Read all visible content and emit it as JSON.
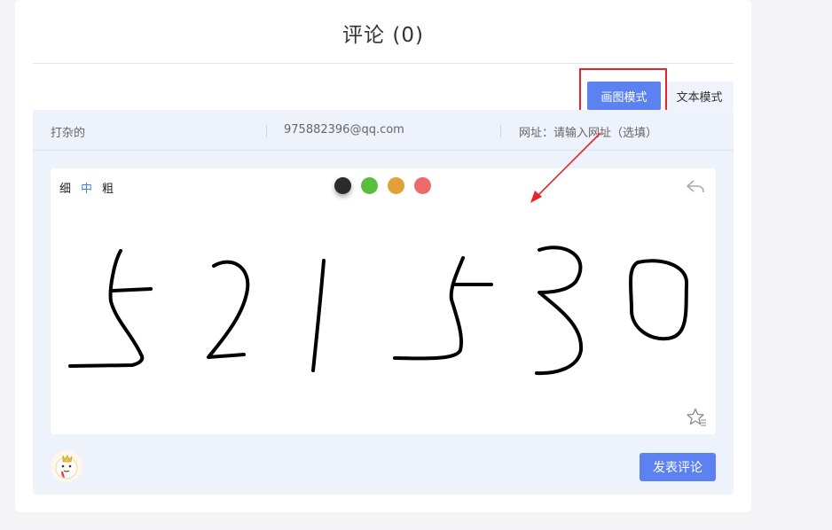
{
  "comments": {
    "title": "评论 (0)"
  },
  "mode_tabs": [
    {
      "label": "画图模式",
      "active": true
    },
    {
      "label": "文本模式",
      "active": false
    }
  ],
  "form": {
    "nickname": "打杂的",
    "email": "975882396@qq.com",
    "website_placeholder": "网址：请输入网址（选填）"
  },
  "brush_sizes": [
    {
      "label": "细",
      "active": false
    },
    {
      "label": "中",
      "active": true
    },
    {
      "label": "粗",
      "active": false
    }
  ],
  "pen_colors": [
    "#2b2b2b",
    "#5bbd3e",
    "#e3a03a",
    "#ee6a6a"
  ],
  "drawing": {
    "handwritten_text": "521530",
    "stroke_color": "#000000"
  },
  "annotations": {
    "highlight_color": "#e5252a",
    "arrow_color": "#e5252a"
  },
  "submit_label": "发表评论",
  "accent_color": "#5b82f0"
}
